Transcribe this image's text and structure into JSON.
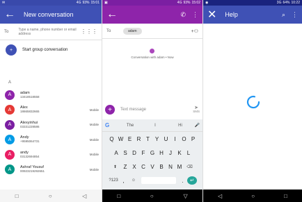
{
  "panel1": {
    "status": {
      "network": "4G",
      "battery": "93%",
      "time": "15:01"
    },
    "title": "New conversation",
    "to_label": "To",
    "to_placeholder": "Type a name, phone number or email address",
    "start_group_label": "Start group conversation",
    "section_letter": "A",
    "contacts": [
      {
        "initial": "A",
        "name": "adam",
        "phone": "13418518558",
        "type": "",
        "color": "#8e24aa"
      },
      {
        "initial": "A",
        "name": "Alex",
        "phone": "18665832665",
        "type": "Mobile",
        "color": "#e53935"
      },
      {
        "initial": "A",
        "name": "Alexyinhui",
        "phone": "03331228586",
        "type": "Mobile",
        "color": "#7b1fa2"
      },
      {
        "initial": "A",
        "name": "Andy",
        "phone": "+9595064731",
        "type": "Mobile",
        "color": "#039be5"
      },
      {
        "initial": "A",
        "name": "andy",
        "phone": "03132694854",
        "type": "Mobile",
        "color": "#e91e63"
      },
      {
        "initial": "A",
        "name": "Ashraf Yousuf",
        "phone": "00923219292651",
        "type": "Mobile",
        "color": "#009688"
      }
    ]
  },
  "panel2": {
    "status": {
      "network": "4G",
      "battery": "93%",
      "time": "15:02"
    },
    "to_label": "To",
    "recipient_chip": "adam",
    "conversation_info": "Conversation with adam • Now",
    "compose_placeholder": "Text message",
    "send_label": "SMS",
    "suggestions": [
      "The",
      "I",
      "Hi"
    ],
    "keyboard_rows": [
      [
        "Q",
        "W",
        "E",
        "R",
        "T",
        "Y",
        "U",
        "I",
        "O",
        "P"
      ],
      [
        "A",
        "S",
        "D",
        "F",
        "G",
        "H",
        "J",
        "K",
        "L"
      ],
      [
        "Z",
        "X",
        "C",
        "V",
        "B",
        "N",
        "M"
      ]
    ],
    "symbols_key": "?123",
    "comma_key": ",",
    "period_key": "."
  },
  "panel3": {
    "status": {
      "network": "3G",
      "battery": "64%",
      "time": "10:22"
    },
    "title": "Help"
  },
  "colors": {
    "p1_appbar": "#3f51b5",
    "p2_appbar": "#8e24aa",
    "p3_appbar": "#3f51b5",
    "spinner": "#2196f3"
  }
}
